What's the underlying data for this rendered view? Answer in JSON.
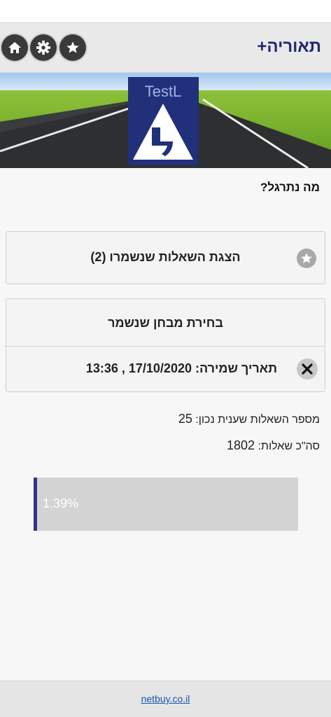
{
  "header": {
    "title": "תאוריה+",
    "buttons": {
      "home": "home-icon",
      "settings": "gear-icon",
      "favorites": "star-icon"
    }
  },
  "banner": {
    "logo_text": "TestL",
    "logo_letter": "ל"
  },
  "practice": {
    "heading": "מה נתרגל?",
    "saved_questions_label": "הצגת השאלות שנשמרו (2)",
    "saved_exam_label": "בחירת מבחן שנשמר",
    "saved_date_label": "תאריך שמירה: 17/10/2020 , 13:36"
  },
  "stats": {
    "correct_label": "מספר השאלות שענית נכון:",
    "correct_value": "25",
    "total_label": "סה\"כ שאלות:",
    "total_value": "1802",
    "progress_text": "1.39%",
    "progress_fraction": 0.0139
  },
  "footer": {
    "link": "netbuy.co.il"
  },
  "colors": {
    "accent": "#2e3582",
    "title": "#1f2a6e",
    "link": "#1b53b5"
  }
}
